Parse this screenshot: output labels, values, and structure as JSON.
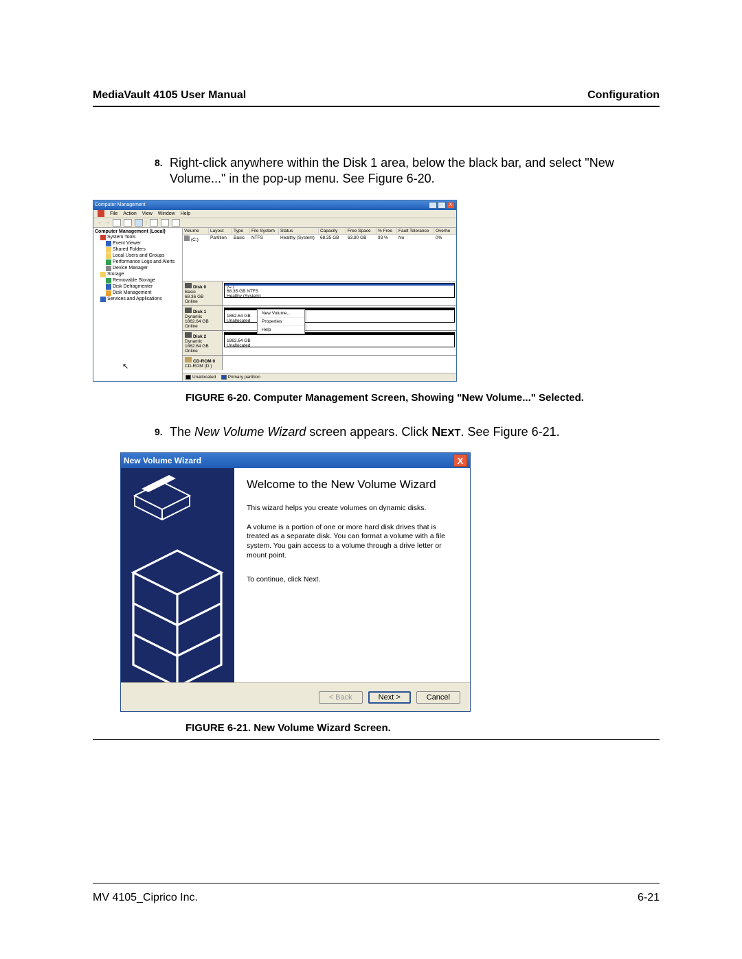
{
  "header": {
    "left": "MediaVault 4105 User Manual",
    "right": "Configuration"
  },
  "step8": {
    "num": "8.",
    "text": "Right-click anywhere within the Disk 1 area, below the black bar, and select \"New Volume...\" in the pop-up menu. See Figure 6-20."
  },
  "fig20": {
    "caption": "FIGURE 6-20. Computer Management Screen, Showing \"New Volume...\" Selected.",
    "title": "Computer Management",
    "menu": [
      "File",
      "Action",
      "View",
      "Window",
      "Help"
    ],
    "tree_root": "Computer Management (Local)",
    "tree": [
      {
        "label": "System Tools",
        "cls": "red"
      },
      {
        "label": "Event Viewer",
        "cls": "blue",
        "l": 2
      },
      {
        "label": "Shared Folders",
        "cls": "folder",
        "l": 2
      },
      {
        "label": "Local Users and Groups",
        "cls": "folder",
        "l": 2
      },
      {
        "label": "Performance Logs and Alerts",
        "cls": "green",
        "l": 2
      },
      {
        "label": "Device Manager",
        "cls": "grey",
        "l": 2
      },
      {
        "label": "Storage",
        "cls": "folder"
      },
      {
        "label": "Removable Storage",
        "cls": "green",
        "l": 2
      },
      {
        "label": "Disk Defragmenter",
        "cls": "blue",
        "l": 2
      },
      {
        "label": "Disk Management",
        "cls": "orange",
        "l": 2
      },
      {
        "label": "Services and Applications",
        "cls": "blue"
      }
    ],
    "vol_headers": [
      "Volume",
      "Layout",
      "Type",
      "File System",
      "Status",
      "Capacity",
      "Free Space",
      "% Free",
      "Fault Tolerance",
      "Overhe"
    ],
    "vol_row": {
      "name": "(C:)",
      "layout": "Partition",
      "type": "Basic",
      "fs": "NTFS",
      "status": "Healthy (System)",
      "capacity": "68.35 GB",
      "free": "63.80 GB",
      "pct": "93 %",
      "fault": "No",
      "over": "0%"
    },
    "disks": [
      {
        "name": "Disk 0",
        "kind": "Basic",
        "size": "68.36 GB",
        "state": "Online",
        "part_line1": "(C:)",
        "part_line2": "68.35 GB NTFS",
        "part_line3": "Healthy (System)",
        "bar": "blue",
        "icon": ""
      },
      {
        "name": "Disk 1",
        "kind": "Dynamic",
        "size": "1862.64 GB",
        "state": "Online",
        "part_line1": "",
        "part_line2": "1862.64 GB",
        "part_line3": "Unallocated",
        "bar": "black",
        "icon": ""
      },
      {
        "name": "Disk 2",
        "kind": "Dynamic",
        "size": "1862.64 GB",
        "state": "Online",
        "part_line1": "",
        "part_line2": "1862.64 GB",
        "part_line3": "Unallocated",
        "bar": "black",
        "icon": ""
      },
      {
        "name": "CD-ROM 0",
        "kind": "CD-ROM (D:)",
        "size": "",
        "state": "",
        "part_line1": "",
        "part_line2": "",
        "part_line3": "",
        "bar": "",
        "icon": "cd"
      }
    ],
    "popup": [
      "New Volume...",
      "Properties",
      "Help"
    ],
    "legend": {
      "un": "Unallocated",
      "pp": "Primary partition"
    }
  },
  "step9": {
    "num": "9.",
    "pre": "The ",
    "ital": "New Volume Wizard",
    "mid": " screen appears. Click ",
    "next1": "N",
    "next2": "EXT",
    "post": ". See Figure 6-21."
  },
  "fig21": {
    "caption": "FIGURE 6-21. New Volume Wizard Screen.",
    "title": "New Volume Wizard",
    "heading": "Welcome to the New Volume Wizard",
    "p1": "This wizard helps you create volumes on dynamic disks.",
    "p2": "A volume is a portion of one or more hard disk drives that is treated as a separate disk. You can format a volume with a file system. You gain access to a volume through a drive letter or mount point.",
    "p3": "To continue, click Next.",
    "btn_back": "< Back",
    "btn_next": "Next >",
    "btn_cancel": "Cancel"
  },
  "footer": {
    "left": "MV 4105_Ciprico Inc.",
    "right": "6-21"
  }
}
